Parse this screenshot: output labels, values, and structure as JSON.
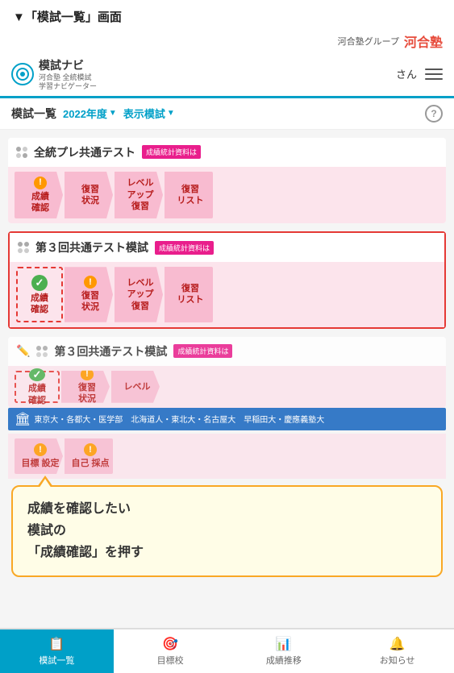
{
  "page": {
    "outer_title": "▼「模試一覧」画面"
  },
  "brand_bar": {
    "group_label": "河合塾グループ",
    "brand_name": "河合塾"
  },
  "app_header": {
    "logo_symbol": "⊙",
    "app_name": "模試ナビ",
    "app_sub1": "河合塾 全統模試",
    "app_sub2": "学習ナビゲーター",
    "user_label": "さん",
    "menu_label": "≡"
  },
  "sub_header": {
    "title": "模試一覧",
    "year_filter": "2022年度",
    "display_filter": "表示模試",
    "help": "?"
  },
  "exam1": {
    "title": "全統プレ共通テスト",
    "badge": "成績統計資料は",
    "steps": [
      {
        "label": "成績\n確認",
        "alert": true,
        "check": false
      },
      {
        "label": "復習\n状況",
        "alert": false,
        "check": false
      },
      {
        "label": "レベル\nアップ\n復習",
        "alert": false,
        "check": false
      },
      {
        "label": "復習\nリスト",
        "alert": false,
        "check": false
      }
    ]
  },
  "exam2": {
    "title": "第３回共通テスト模試",
    "badge": "成績統計資料は",
    "steps": [
      {
        "label": "成績\n確認",
        "alert": false,
        "check": true
      },
      {
        "label": "復習\n状況",
        "alert": true,
        "check": false
      },
      {
        "label": "レベル\nアップ\n復習",
        "alert": false,
        "check": false
      },
      {
        "label": "復習\nリスト",
        "alert": false,
        "check": false
      }
    ]
  },
  "exam3": {
    "title": "第３回共通テスト模試",
    "badge": "成績統計資料は",
    "steps": [
      {
        "label": "成績\n確認",
        "alert": false,
        "check": true
      },
      {
        "label": "復習\n状況",
        "alert": true,
        "check": false
      },
      {
        "label": "レベル",
        "alert": false,
        "check": false
      }
    ]
  },
  "university_strip": {
    "text": "東京大・各都大・医学部　北海道人・東北大・名古屋大　早稲田大・慶應義塾大"
  },
  "lower_steps": [
    {
      "label": "目標\n設定",
      "alert": true
    },
    {
      "label": "自己\n採点",
      "alert": true
    }
  ],
  "tooltip": {
    "line1": "成績を確認したい",
    "line2": "模試の",
    "line3": "「成績確認」を押す"
  },
  "bottom_nav": {
    "items": [
      {
        "icon": "📋",
        "label": "模試一覧",
        "active": true
      },
      {
        "icon": "🎯",
        "label": "目標校",
        "active": false
      },
      {
        "icon": "📊",
        "label": "成績推移",
        "active": false
      },
      {
        "icon": "🔔",
        "label": "お知らせ",
        "active": false
      }
    ]
  }
}
